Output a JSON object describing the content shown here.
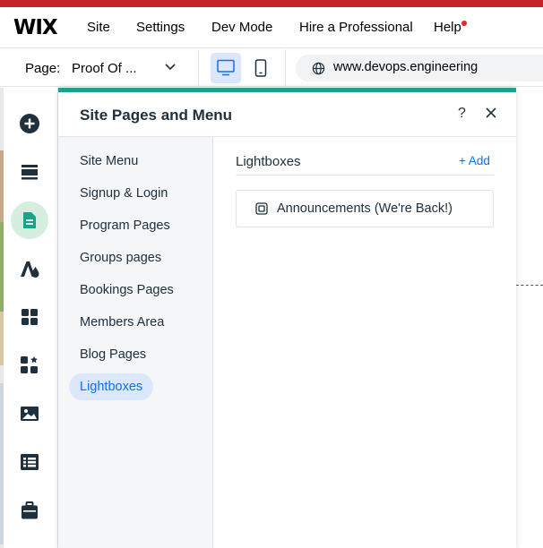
{
  "topbar": {
    "logo": "WIX",
    "menu": [
      "Site",
      "Settings",
      "Dev Mode",
      "Hire a Professional",
      "Help"
    ]
  },
  "secondary_bar": {
    "page_label": "Page:",
    "page_value": "Proof Of ...",
    "url": "www.devops.engineering"
  },
  "left_rail": {
    "icons": [
      "add-icon",
      "sections-icon",
      "pages-icon",
      "design-icon",
      "apps-icon",
      "business-apps-icon",
      "media-icon",
      "cms-icon",
      "portfolio-icon"
    ],
    "active": "pages-icon"
  },
  "panel": {
    "title": "Site Pages and Menu",
    "help": "?",
    "nav_items": [
      "Site Menu",
      "Signup & Login",
      "Program Pages",
      "Groups pages",
      "Bookings Pages",
      "Members Area",
      "Blog Pages",
      "Lightboxes"
    ],
    "active_nav": "Lightboxes",
    "section": {
      "title": "Lightboxes",
      "add_label": "+ Add",
      "items": [
        "Announcements (We're Back!)"
      ]
    }
  },
  "colors": {
    "accent_blue": "#116dff",
    "panel_top_border": "#1ba38a",
    "active_rail_bg": "#d5eedf",
    "active_nav_bg": "#dbe8fb",
    "notification_dot": "#e02828"
  }
}
